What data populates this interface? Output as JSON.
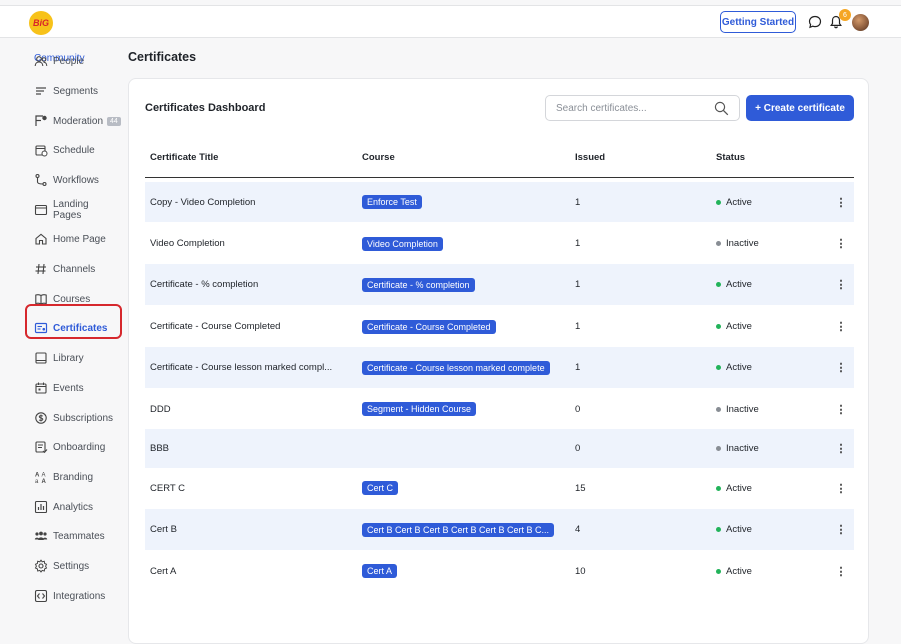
{
  "header": {
    "logo_text": "BiG",
    "getting_started_label": "Getting Started",
    "notification_count": "6"
  },
  "sidebar": {
    "section": "Community",
    "items": [
      {
        "label": "People",
        "icon": "people-icon"
      },
      {
        "label": "Segments",
        "icon": "segments-icon"
      },
      {
        "label": "Moderation",
        "icon": "moderation-icon",
        "badge": "44"
      },
      {
        "label": "Schedule",
        "icon": "schedule-icon"
      },
      {
        "label": "Workflows",
        "icon": "workflows-icon"
      },
      {
        "label": "Landing Pages",
        "icon": "landing-pages-icon"
      },
      {
        "label": "Home Page",
        "icon": "home-icon"
      },
      {
        "label": "Channels",
        "icon": "hash-icon"
      },
      {
        "label": "Courses",
        "icon": "book-icon"
      },
      {
        "label": "Certificates",
        "icon": "certificate-icon",
        "active": true
      },
      {
        "label": "Library",
        "icon": "library-icon"
      },
      {
        "label": "Events",
        "icon": "events-icon"
      },
      {
        "label": "Subscriptions",
        "icon": "subscriptions-icon"
      },
      {
        "label": "Onboarding",
        "icon": "onboarding-icon"
      },
      {
        "label": "Branding",
        "icon": "branding-icon"
      },
      {
        "label": "Analytics",
        "icon": "analytics-icon"
      },
      {
        "label": "Teammates",
        "icon": "teammates-icon"
      },
      {
        "label": "Settings",
        "icon": "settings-icon"
      },
      {
        "label": "Integrations",
        "icon": "integrations-icon"
      }
    ]
  },
  "main": {
    "page_title": "Certificates",
    "dashboard_title": "Certificates Dashboard",
    "search_placeholder": "Search certificates...",
    "create_label": "+ Create certificate",
    "columns": [
      "Certificate Title",
      "Course",
      "Issued",
      "Status"
    ],
    "rows": [
      {
        "title": "Copy - Video Completion",
        "course": "Enforce Test",
        "issued": "1",
        "status": "Active"
      },
      {
        "title": "Video Completion",
        "course": "Video Completion",
        "issued": "1",
        "status": "Inactive"
      },
      {
        "title": "Certificate - % completion",
        "course": "Certificate - % completion",
        "issued": "1",
        "status": "Active"
      },
      {
        "title": "Certificate - Course Completed",
        "course": "Certificate - Course Completed",
        "issued": "1",
        "status": "Active"
      },
      {
        "title": "Certificate - Course lesson marked compl...",
        "course": "Certificate - Course lesson marked complete",
        "issued": "1",
        "status": "Active"
      },
      {
        "title": "DDD",
        "course": "Segment - Hidden Course",
        "issued": "0",
        "status": "Inactive"
      },
      {
        "title": "BBB",
        "course": "",
        "issued": "0",
        "status": "Inactive"
      },
      {
        "title": "CERT C",
        "course": "Cert C",
        "issued": "15",
        "status": "Active"
      },
      {
        "title": "Cert B",
        "course": "Cert B Cert B Cert B Cert B Cert B Cert B C...",
        "issued": "4",
        "status": "Active"
      },
      {
        "title": "Cert A",
        "course": "Cert A",
        "issued": "10",
        "status": "Active"
      }
    ],
    "menu_glyph": "⋮"
  },
  "colors": {
    "accent": "#2f5bd8",
    "active_status": "#22b35a",
    "inactive_status": "#888d94",
    "highlight_outline": "#d6282d",
    "row_alt": "#eef3fc"
  }
}
